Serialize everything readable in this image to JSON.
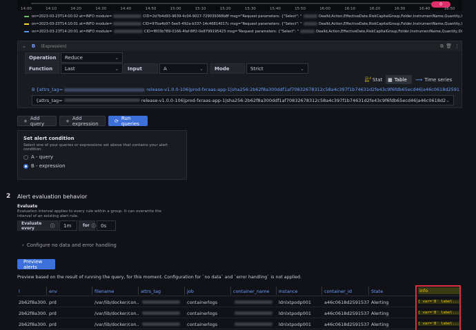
{
  "timeline": {
    "ticks": [
      "14:00",
      "14:10",
      "14:20",
      "14:30",
      "14:40",
      "14:50",
      "15:00",
      "15:10",
      "15:20",
      "15:30",
      "15:40",
      "15:50",
      "16:00",
      "16:10",
      "16:20",
      "16:30",
      "16:40",
      "16:50"
    ],
    "badge": "0"
  },
  "logs": [
    {
      "color": "#73bf69",
      "prefix": "on=2023-03-23T14:00:02 at=INFO module=",
      "cid": "CID=2d7b4d93-9639-4c04-9027-729039368b8f msg=\"Request parameters: {\"Select\": \"",
      "tail": "DealId,Action,EffectiveDate,RiskCapitalGroup,Folder,InstrumentName,Quantity,I"
    },
    {
      "color": "#fade2a",
      "prefix": "on=2023-03-23T14:10:01 at=INFO module=",
      "cid": "CID=97ba4b97-5ee5-492a-b337-14c46814017c msg=\"Request parameters: {\"Select\": \"",
      "tail": "DealId,Action,EffectiveDate,RiskCapitalGroup,Folder,InstrumentName,Quantity,I"
    },
    {
      "color": "#5794f2",
      "prefix": "on=2023-03-23T14:20:01 at=INFO module=",
      "cid": "CID=f803b789-0166-4faf-8ff2-0e8799195423 msg=\"Request parameters: {\"Select\": \"",
      "tail": "DealId,Action,EffectiveDate,RiskCapitalGroup,Folder,InstrumentName,Quantity,Di"
    }
  ],
  "expression": {
    "ref": "B",
    "type": "(Expression)",
    "operation_label": "Operation",
    "operation_value": "Reduce",
    "function_label": "Function",
    "function_value": "Last",
    "input_label": "Input",
    "input_value": "A",
    "mode_label": "Mode",
    "mode_value": "Strict",
    "view_tabs": [
      "Stat",
      "Table",
      "Time series"
    ],
    "active_tab": "Table",
    "series_title": "B {attrs_tag=",
    "series_title_tail": "release-v1.0.0-106|prod-fxraas-app-1|sha256:2b62f8a300ddf1af70832678312c58a4c397f1b74631d2fe43c9f6fdb65ecd46|a46c0618d2591",
    "series_select": "{attrs_tag=",
    "series_select_tail": "release-v1.0.0-106|prod-fxraas-app-1|sha256:2b62f8a300ddf1af70832678312c58a4c397f1b74631d2fe43c9f6fdb65ecd46|a46c0618d2"
  },
  "actions": {
    "add_query": "Add query",
    "add_expression": "Add expression",
    "run_queries": "Run queries"
  },
  "alert_condition": {
    "title": "Set alert condition",
    "description": "Select one of your queries or expressions set above that contains your alert condition.",
    "options": [
      "A - query",
      "B - expression"
    ],
    "selected": "B - expression"
  },
  "evaluation": {
    "step": "2",
    "heading": "Alert evaluation behavior",
    "subheading": "Evaluate",
    "description": "Evaluation interval applies to every rule within a group. It can overwrite the interval of an existing alert rule.",
    "every_label": "Evaluate every",
    "every_value": "1m",
    "for_label": "for",
    "for_value": "0s",
    "nodata_link": "Configure no data and error handling"
  },
  "preview": {
    "button": "Preview alerts",
    "note": "Preview based on the result of running the query, for this moment. Configuration for `no data` and `error handling` is not applied.",
    "columns": [
      "l",
      "env",
      "filename",
      "attrs_tag",
      "job",
      "container_name",
      "instance",
      "container_id",
      "State",
      "info"
    ],
    "rows": [
      [
        "2b62f8a300...",
        "prd",
        "/var/lib/docker/con...",
        "",
        "containerlogs",
        "",
        "ldnlxtpodp001",
        "a46c0618d2591537...",
        "Alerting",
        "[ var='B' label..."
      ],
      [
        "2b62f8a300...",
        "prd",
        "/var/lib/docker/con...",
        "",
        "containerlogs",
        "",
        "ldnlxtpodp001",
        "a46c0618d2591537...",
        "Alerting",
        "[ var='B' label..."
      ],
      [
        "2b62f8a300...",
        "prd",
        "/var/lib/docker/con...",
        "",
        "containerlogs",
        "",
        "ldnlxtpodp001",
        "a46c0618d2591537...",
        "Alerting",
        "[ var='B' label..."
      ]
    ]
  },
  "colors": {
    "accent": "#3d71d9",
    "highlight_border": "#e02f44",
    "info_text": "#f2cc0c"
  }
}
